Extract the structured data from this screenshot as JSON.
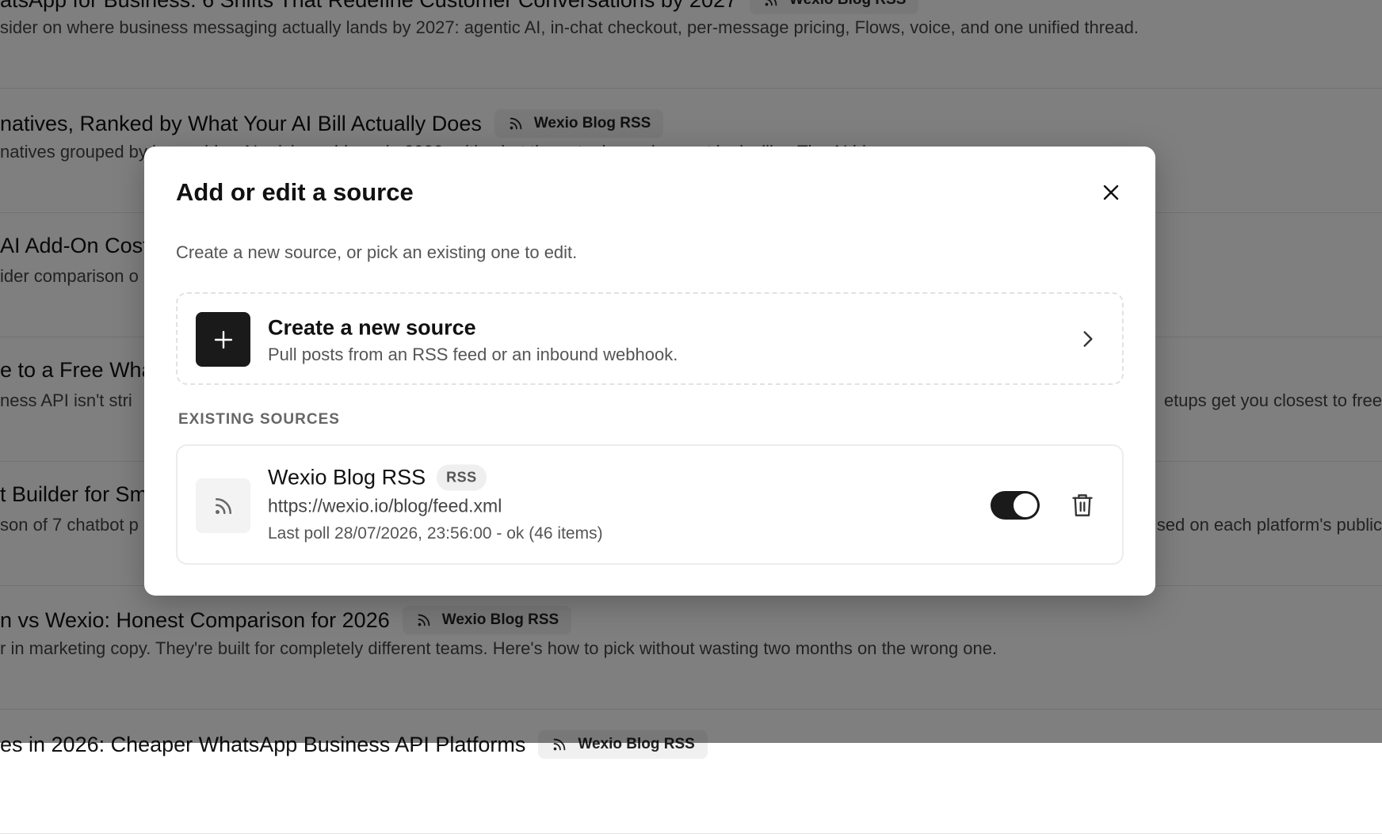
{
  "feed": {
    "items": [
      {
        "title": "atsApp for Business: 6 Shifts That Redefine Customer Conversations by 2027",
        "summary": "sider on where business messaging actually lands by 2027: agentic AI, in-chat checkout, per-message pricing, Flows, voice, and one unified thread.",
        "source": "Wexio Blog RSS"
      },
      {
        "title": "natives, Ranked by What Your AI Bill Actually Does",
        "summary": "natives grouped by how addon AI pricing adds up in 2026, with what the actual per-plan cost looks like. The AI bi",
        "source": "Wexio Blog RSS"
      },
      {
        "title": "AI Add-On Cost",
        "summary": "ider comparison o",
        "source": ""
      },
      {
        "title": "e to a Free Wha",
        "summary": "ness API isn't stri",
        "summary_right": "etups get you closest to free",
        "source": ""
      },
      {
        "title": "t Builder for Sm",
        "summary": "son of 7 chatbot p",
        "summary_right": "sed on each platform's public",
        "source": ""
      },
      {
        "title": "n vs Wexio: Honest Comparison for 2026",
        "summary": "r in marketing copy. They're built for completely different teams. Here's how to pick without wasting two months on the wrong one.",
        "source": "Wexio Blog RSS"
      },
      {
        "title": "es in 2026: Cheaper WhatsApp Business API Platforms",
        "summary": "",
        "source": "Wexio Blog RSS"
      }
    ]
  },
  "modal": {
    "title": "Add or edit a source",
    "description": "Create a new source, or pick an existing one to edit.",
    "close_icon": "close-icon",
    "create": {
      "title": "Create a new source",
      "subtitle": "Pull posts from an RSS feed or an inbound webhook.",
      "icon": "plus-icon"
    },
    "existing_label": "EXISTING SOURCES",
    "sources": [
      {
        "name": "Wexio Blog RSS",
        "type": "RSS",
        "url": "https://wexio.io/blog/feed.xml",
        "status": "Last poll 28/07/2026, 23:56:00 - ok (46 items)",
        "enabled": true,
        "icon": "rss-icon"
      }
    ]
  },
  "colors": {
    "overlay": "rgba(0,0,0,0.5)",
    "accent_dark": "#1a1a1a",
    "chip_bg": "#f0f0f0"
  }
}
